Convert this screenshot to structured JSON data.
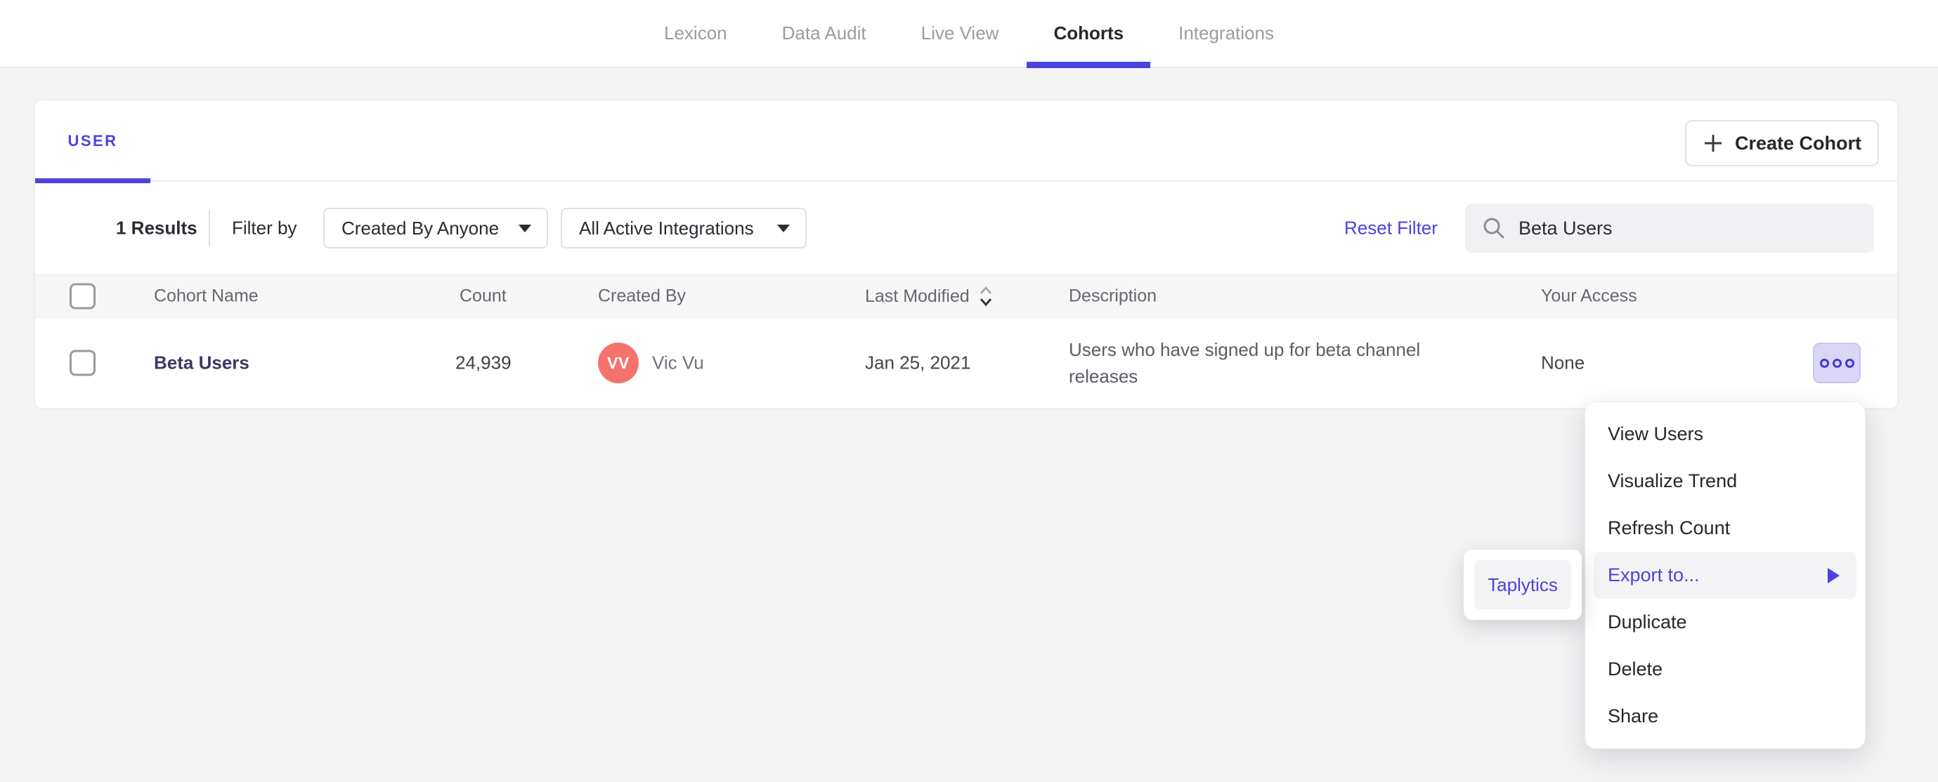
{
  "colors": {
    "accent": "#4c43dd",
    "accent_button_bg": "#dad6f7",
    "avatar_bg": "#f4736d",
    "page_bg": "#f4f4f5",
    "menu_highlight_bg": "#f4f4f6",
    "table_header_bg": "#f7f7f8"
  },
  "nav": {
    "active_tab": "Cohorts",
    "tabs": [
      {
        "label": "Lexicon"
      },
      {
        "label": "Data Audit"
      },
      {
        "label": "Live View"
      },
      {
        "label": "Cohorts"
      },
      {
        "label": "Integrations"
      }
    ]
  },
  "panel": {
    "user_tab": "USER",
    "create_cohort": "Create Cohort",
    "filters": {
      "results": "1 Results",
      "filter_by": "Filter by",
      "created_by_dropdown": "Created By Anyone",
      "integrations_dropdown": "All Active Integrations",
      "reset_filter": "Reset Filter",
      "search_value": "Beta Users"
    },
    "table": {
      "headers": {
        "cohort_name": "Cohort Name",
        "count": "Count",
        "created_by": "Created By",
        "last_modified": "Last Modified",
        "description": "Description",
        "your_access": "Your Access"
      },
      "row": {
        "name": "Beta Users",
        "count": "24,939",
        "creator_initials": "VV",
        "creator_name": "Vic Vu",
        "last_modified": "Jan 25, 2021",
        "description": "Users who have signed up for beta channel releases",
        "access": "None"
      }
    }
  },
  "context_menu": {
    "highlighted_item": "Export to...",
    "items": [
      "View Users",
      "Visualize Trend",
      "Refresh Count",
      "Export to...",
      "Duplicate",
      "Delete",
      "Share"
    ],
    "submenu": {
      "items": [
        "Taplytics"
      ]
    }
  }
}
